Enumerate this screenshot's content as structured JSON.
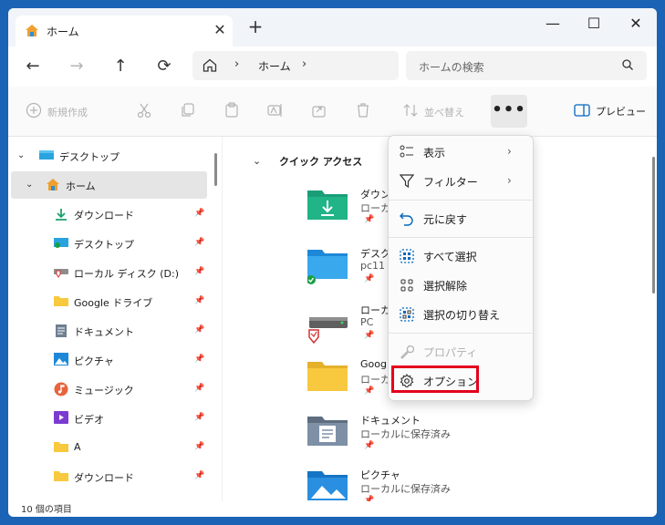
{
  "window": {
    "tab_title": "ホーム",
    "tab_close": "✕",
    "new_tab": "+",
    "controls": {
      "minimize": "—",
      "maximize": "☐",
      "close": "✕"
    }
  },
  "nav": {
    "back": "←",
    "forward": "→",
    "up": "↑",
    "refresh": "⟳",
    "breadcrumb_sep": "›",
    "breadcrumb": "ホーム",
    "search_placeholder": "ホームの検索"
  },
  "toolbar": {
    "new_label": "新規作成",
    "sort_label": "並べ替え",
    "more_label": "•••",
    "preview_label": "プレビュー"
  },
  "sidebar": {
    "items": [
      {
        "label": "デスクトップ",
        "icon": "desktop-icon"
      },
      {
        "label": "ホーム",
        "icon": "home-icon"
      },
      {
        "label": "ダウンロード",
        "icon": "download-icon"
      },
      {
        "label": "デスクトップ",
        "icon": "desktop-icon"
      },
      {
        "label": "ローカル ディスク (D:)",
        "icon": "drive-icon"
      },
      {
        "label": "Google ドライブ",
        "icon": "folder-icon"
      },
      {
        "label": "ドキュメント",
        "icon": "document-icon"
      },
      {
        "label": "ピクチャ",
        "icon": "pictures-icon"
      },
      {
        "label": "ミュージック",
        "icon": "music-icon"
      },
      {
        "label": "ビデオ",
        "icon": "video-icon"
      },
      {
        "label": "A",
        "icon": "folder-icon"
      },
      {
        "label": "ダウンロード",
        "icon": "folder-icon"
      }
    ],
    "pin_glyph": "📌"
  },
  "content": {
    "section_title": "クイック アクセス",
    "items": [
      {
        "name": "ダウンロ",
        "sub": "ローカル",
        "icon": "download-folder-icon"
      },
      {
        "name": "デスク",
        "sub": "pc11",
        "icon": "desktop-folder-icon"
      },
      {
        "name": "ローカル",
        "sub": "PC",
        "icon": "drive-icon"
      },
      {
        "name": "Goog",
        "sub": "ローカル",
        "icon": "folder-icon"
      },
      {
        "name": "ドキュメント",
        "sub": "ローカルに保存済み",
        "icon": "documents-folder-icon"
      },
      {
        "name": "ピクチャ",
        "sub": "ローカルに保存済み",
        "icon": "pictures-folder-icon"
      }
    ]
  },
  "menu": {
    "items": [
      {
        "label": "表示",
        "submenu": true,
        "icon": "view-icon"
      },
      {
        "label": "フィルター",
        "submenu": true,
        "icon": "filter-icon"
      },
      {
        "label": "元に戻す",
        "icon": "undo-icon"
      },
      {
        "label": "すべて選択",
        "icon": "select-all-icon"
      },
      {
        "label": "選択解除",
        "icon": "select-none-icon"
      },
      {
        "label": "選択の切り替え",
        "icon": "invert-selection-icon"
      },
      {
        "label": "プロパティ",
        "disabled": true,
        "icon": "properties-icon"
      },
      {
        "label": "オプション",
        "icon": "gear-icon",
        "highlighted": true
      }
    ],
    "arrow": "›"
  },
  "status": {
    "item_count": "10 個の項目"
  },
  "colors": {
    "desktop_bg": "#1a63b5",
    "highlight_border": "#e3001b",
    "accent": "#0067c0",
    "folder": "#f8c93e"
  }
}
